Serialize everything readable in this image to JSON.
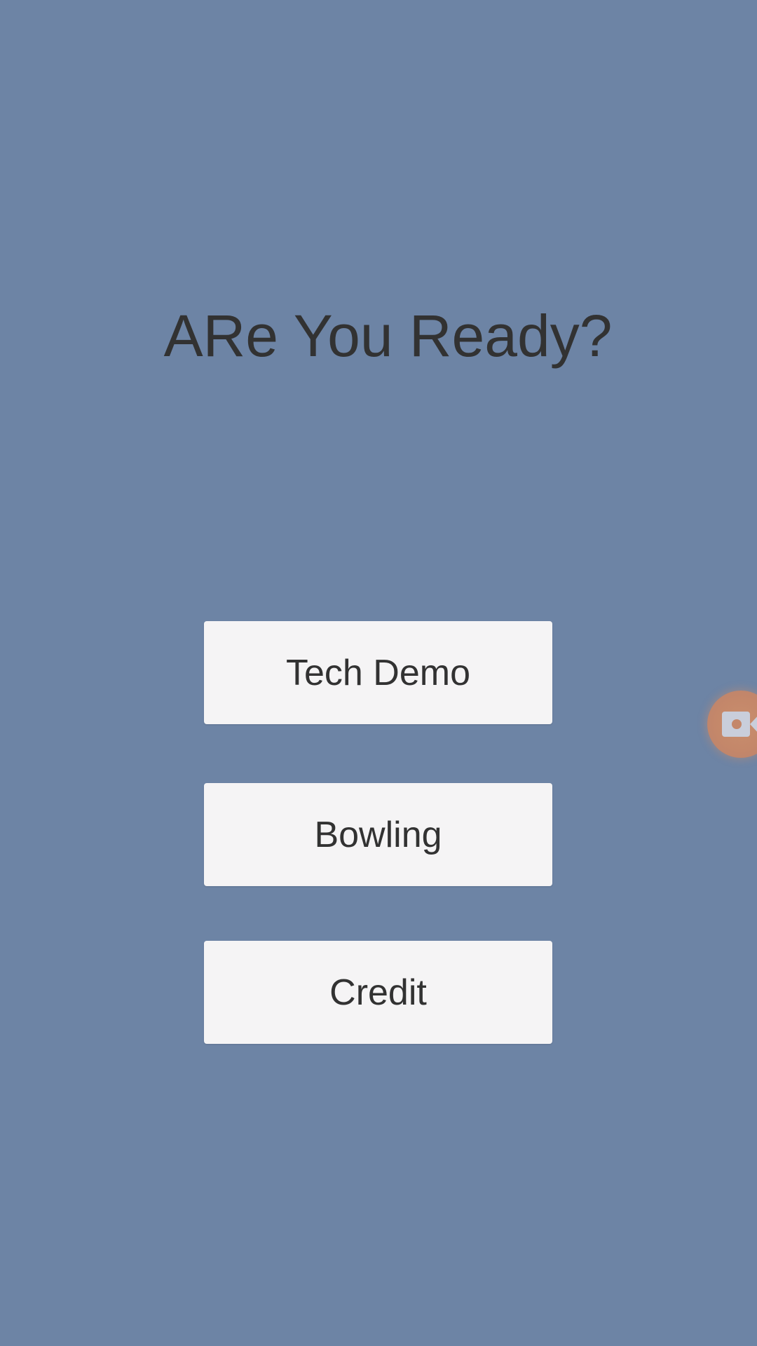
{
  "screen": {
    "background_color": "#6d84a5",
    "title": "ARe You Ready?"
  },
  "menu": {
    "buttons": [
      {
        "label": "Tech Demo"
      },
      {
        "label": "Bowling"
      },
      {
        "label": "Credit"
      }
    ],
    "button_color": "#f5f4f5",
    "text_color": "#323232"
  },
  "overlay": {
    "record_button_icon": "video-camera-icon",
    "record_button_color": "#c4876a"
  }
}
